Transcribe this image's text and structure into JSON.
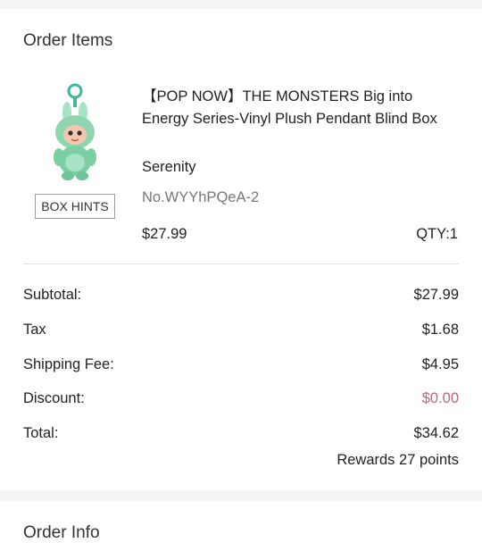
{
  "order_items": {
    "title": "Order Items",
    "item": {
      "box_hints_label": "BOX HINTS",
      "title": "【POP NOW】THE MONSTERS Big into Energy Series-Vinyl Plush Pendant Blind Box",
      "variant": "Serenity",
      "sku": "No.WYYhPQeA-2",
      "price": "$27.99",
      "qty": "QTY:1"
    },
    "summary": {
      "subtotal_label": "Subtotal:",
      "subtotal_value": "$27.99",
      "tax_label": "Tax",
      "tax_value": "$1.68",
      "shipping_label": "Shipping Fee:",
      "shipping_value": "$4.95",
      "discount_label": "Discount:",
      "discount_value": "$0.00",
      "total_label": "Total:",
      "total_value": "$34.62",
      "rewards": "Rewards 27 points"
    },
    "colors": {
      "discount": "#c0647a",
      "plush": "#8fd6b0"
    }
  },
  "order_info": {
    "title": "Order Info"
  }
}
